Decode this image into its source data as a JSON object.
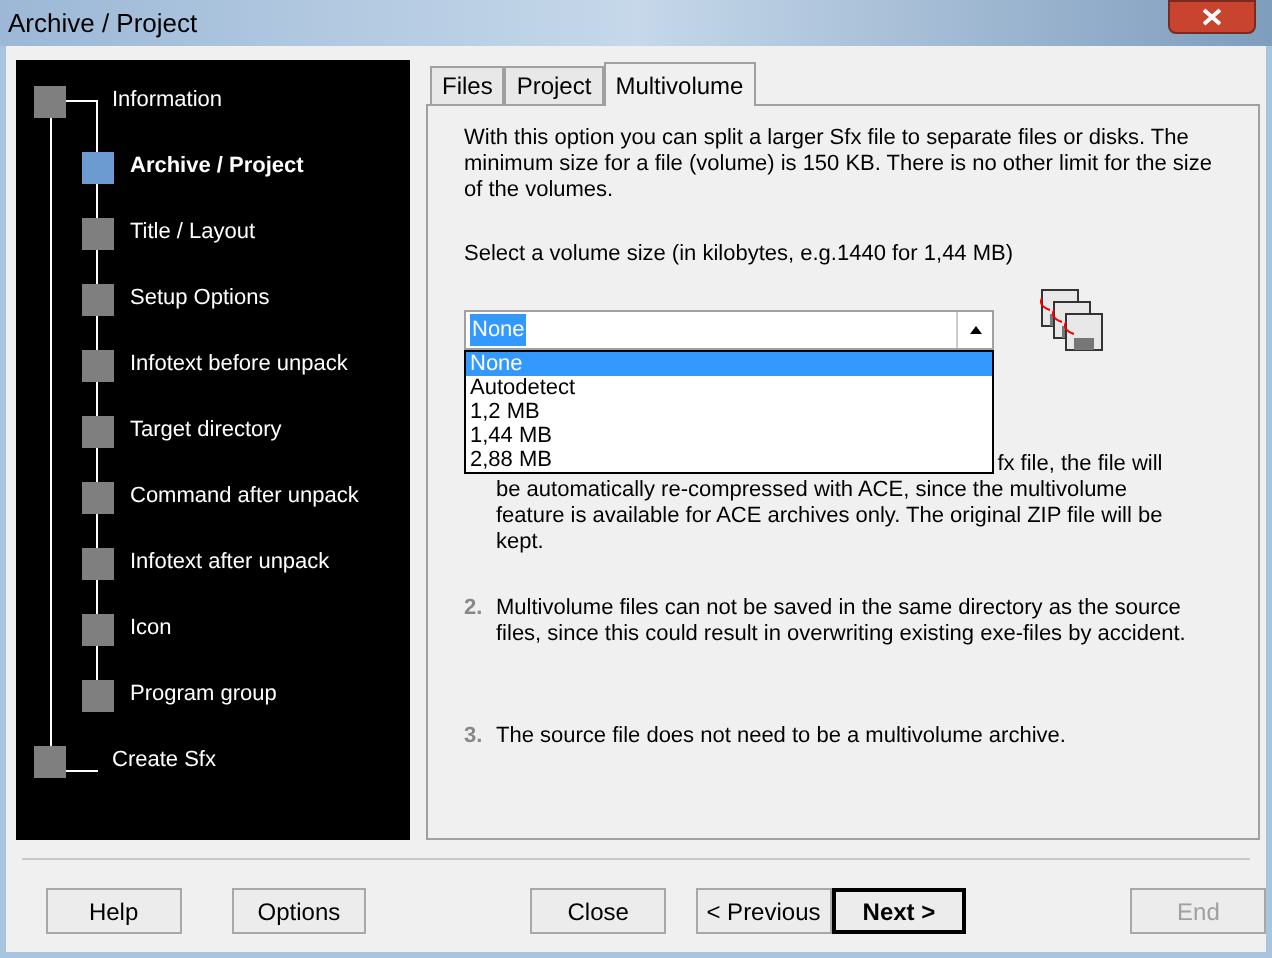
{
  "window": {
    "title": "Archive / Project"
  },
  "steps": [
    {
      "label": "Information",
      "selected": false,
      "children": [
        {
          "label": "Archive / Project",
          "selected": true
        },
        {
          "label": "Title / Layout",
          "selected": false
        },
        {
          "label": "Setup Options",
          "selected": false
        },
        {
          "label": "Infotext before unpack",
          "selected": false
        },
        {
          "label": "Target directory",
          "selected": false
        },
        {
          "label": "Command after unpack",
          "selected": false
        },
        {
          "label": "Infotext after unpack",
          "selected": false
        },
        {
          "label": "Icon",
          "selected": false
        },
        {
          "label": "Program group",
          "selected": false
        }
      ]
    },
    {
      "label": "Create Sfx",
      "selected": false
    }
  ],
  "tabs": [
    {
      "label": "Files",
      "selected": false
    },
    {
      "label": "Project",
      "selected": false
    },
    {
      "label": "Multivolume",
      "selected": true
    }
  ],
  "intro": "With this option you can split a larger Sfx file to separate files or disks. The minimum size for a file (volume) is 150 KB. There is no other limit for the size of the volumes.",
  "volume_label": "Select a volume size (in kilobytes, e.g.1440 for 1,44 MB)",
  "volume_select": {
    "value": "None",
    "expanded": true,
    "options": [
      {
        "label": "None",
        "selected": true
      },
      {
        "label": "Autodetect",
        "selected": false
      },
      {
        "label": "1,2 MB",
        "selected": false
      },
      {
        "label": "1,44 MB",
        "selected": false
      },
      {
        "label": "2,88 MB",
        "selected": false
      }
    ]
  },
  "notes": [
    {
      "lines": [
        "fx file, the file will",
        "be automatically re-compressed with ACE, since the multivolume",
        "feature is available for ACE archives only. The original ZIP file will be",
        "kept."
      ]
    },
    {
      "number": "2.",
      "lines": [
        "Multivolume files can not be saved in the same directory as the source",
        "files, since this could result in overwriting existing exe-files by accident."
      ]
    },
    {
      "number": "3.",
      "lines": [
        "The source file does not need to be a multivolume archive."
      ]
    }
  ],
  "buttons": [
    {
      "label": "Help",
      "kind": "normal",
      "disabled": false
    },
    {
      "label": "Options",
      "kind": "normal",
      "disabled": false
    },
    {
      "label": "Close",
      "kind": "gap",
      "disabled": false
    },
    {
      "label": "< Previous",
      "kind": "normal",
      "disabled": false
    },
    {
      "label": "Next >",
      "kind": "default",
      "disabled": false
    },
    {
      "label": "End",
      "kind": "gap",
      "disabled": true
    }
  ]
}
